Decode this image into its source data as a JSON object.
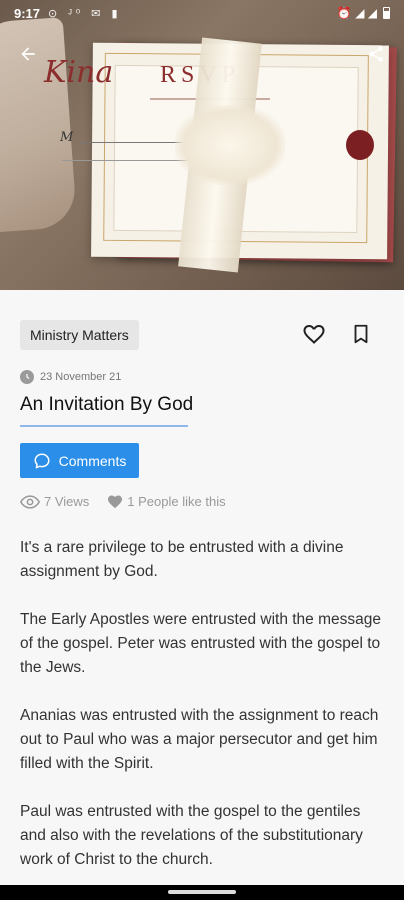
{
  "status_bar": {
    "time": "9:17",
    "notification_icons": "⊙ ᴶ⁰ ✉ ▮",
    "right_icons": "⏰ ◢ ◢"
  },
  "hero": {
    "script_text": "Kina",
    "rsvp_text": "RSVP",
    "m_text": "M"
  },
  "article": {
    "category": "Ministry Matters",
    "date": "23 November 21",
    "title": "An Invitation By God",
    "comments_label": "Comments",
    "views": "7 Views",
    "likes": "1 People like this",
    "paragraphs": [
      "It's a rare privilege to be entrusted with a divine assignment by God.",
      "The Early Apostles were entrusted with the message of the gospel. Peter was entrusted with the gospel to the Jews.",
      "Ananias was entrusted with the assignment to reach out to Paul who was a major persecutor and get him filled with the Spirit.",
      "Paul was entrusted with the gospel to the gentiles and also with the revelations of the substitutionary work of Christ to the church."
    ]
  },
  "colors": {
    "accent": "#2b8ee8",
    "underline": "#8fb7e8",
    "chip_bg": "#e6e6e6"
  },
  "icons": {
    "back": "arrow-left-icon",
    "share": "share-icon",
    "like": "heart-outline-icon",
    "bookmark": "bookmark-outline-icon",
    "date": "clock-icon",
    "comments": "chat-bubble-icon",
    "views": "eye-icon",
    "likes": "heart-filled-icon"
  }
}
